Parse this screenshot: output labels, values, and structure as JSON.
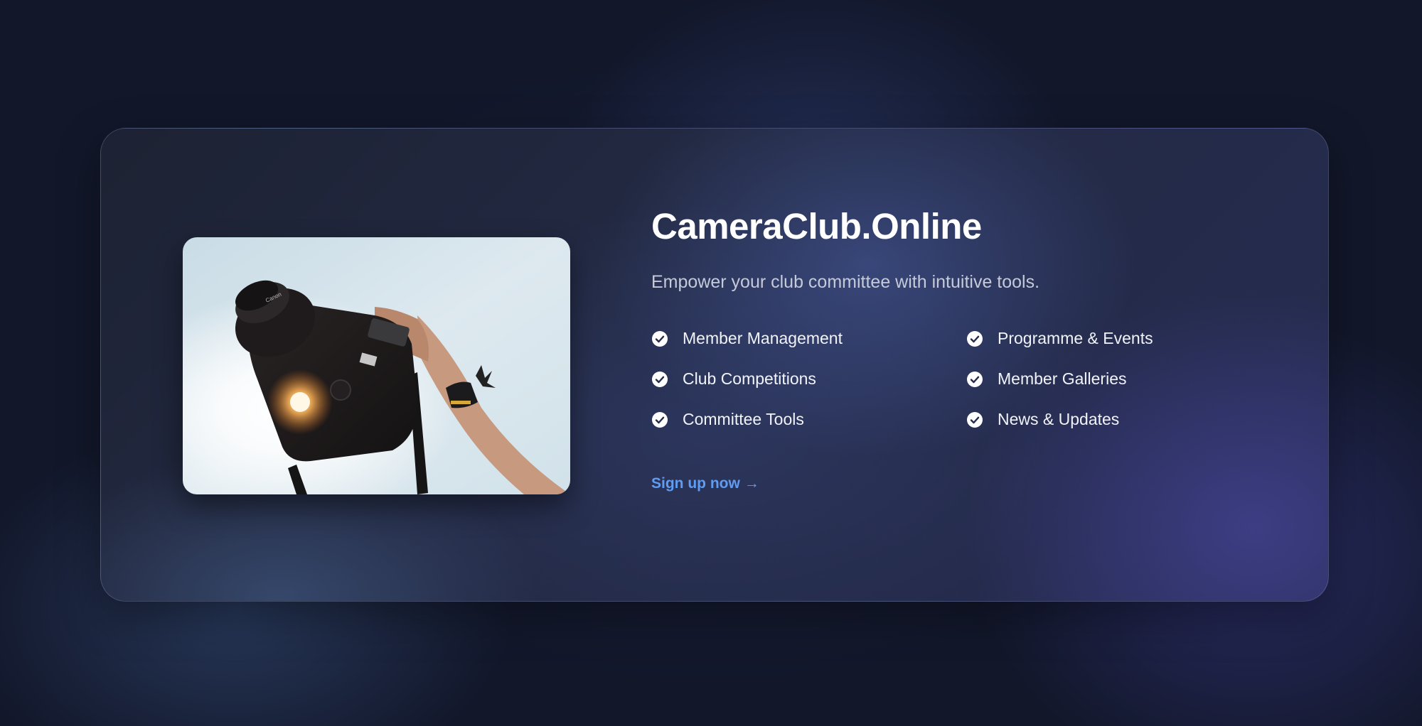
{
  "brand": {
    "title": "CameraClub.Online",
    "tagline": "Empower your club committee with intuitive tools."
  },
  "hero_image": {
    "alt": "Photographer holding a camera up against a bright sky with the sun flaring behind it",
    "camera_brand_text": "Canon"
  },
  "features": [
    {
      "label": "Member Management",
      "icon": "check-circle-icon"
    },
    {
      "label": "Programme & Events",
      "icon": "check-circle-icon"
    },
    {
      "label": "Club Competitions",
      "icon": "check-circle-icon"
    },
    {
      "label": "Member Galleries",
      "icon": "check-circle-icon"
    },
    {
      "label": "Committee Tools",
      "icon": "check-circle-icon"
    },
    {
      "label": "News & Updates",
      "icon": "check-circle-icon"
    }
  ],
  "cta": {
    "label": "Sign up now",
    "arrow": "→"
  },
  "colors": {
    "background": "#12172a",
    "card": "#232a44",
    "title": "#ffffff",
    "subtitle": "#c5cad9",
    "feature_text": "#f1f3f8",
    "accent_link": "#5f9cf2"
  }
}
